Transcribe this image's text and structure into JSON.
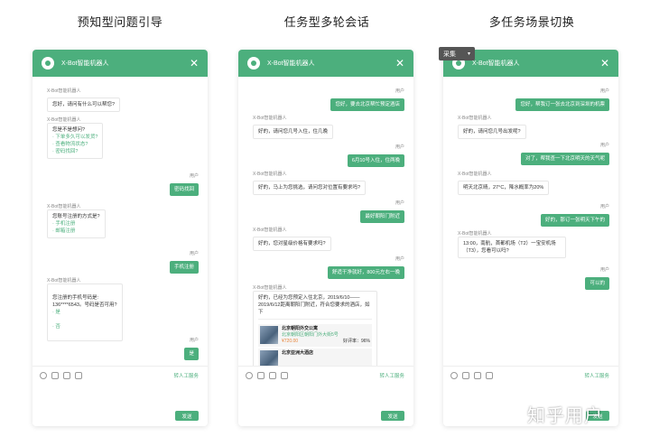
{
  "columns": [
    {
      "title": "预知型问题引导",
      "window_title": "X-Bot智能机器人",
      "messages": [
        {
          "side": "left",
          "sender": "X-Bot智能机器人",
          "text": "您好，请问有什么可以帮您?"
        },
        {
          "side": "left",
          "sender": "X-Bot智能机器人",
          "text": "您是不是想问?",
          "options": [
            "· 下单多久可以发货?",
            "· 查看物流状态?",
            "· 密码找回?"
          ]
        },
        {
          "side": "right",
          "sender": "用户",
          "text": "密码找回"
        },
        {
          "side": "left",
          "sender": "X-Bot智能机器人",
          "text": "您账号注册的方式是?",
          "options": [
            "· 手机注册",
            "· 邮箱注册"
          ]
        },
        {
          "side": "right",
          "sender": "用户",
          "text": "手机注册"
        },
        {
          "side": "left",
          "sender": "X-Bot智能机器人",
          "text": "您注册的手机号码是:\n136****6543。号码是否可用?",
          "options": [
            "· 是",
            "· 否"
          ]
        },
        {
          "side": "right",
          "sender": "用户",
          "text": "是"
        }
      ],
      "human_service": "转人工服务",
      "send": "发送"
    },
    {
      "title": "任务型多轮会话",
      "window_title": "X-Bot智能机器人",
      "messages": [
        {
          "side": "right",
          "sender": "用户",
          "text": "您好，要去北京帮忙预定酒店"
        },
        {
          "side": "left",
          "sender": "X-Bot智能机器人",
          "text": "好的，请问您几号入住，住几晚"
        },
        {
          "side": "right",
          "sender": "用户",
          "text": "6月10号入住，住两晚"
        },
        {
          "side": "left",
          "sender": "X-Bot智能机器人",
          "text": "好的，马上为您挑选，请问您对位置有要求吗?"
        },
        {
          "side": "right",
          "sender": "用户",
          "text": "最好朝阳门附近"
        },
        {
          "side": "left",
          "sender": "X-Bot智能机器人",
          "text": "好的，您对星级价格有要求吗?"
        },
        {
          "side": "right",
          "sender": "用户",
          "text": "舒适干净就好，800元左右一晚"
        },
        {
          "side": "left",
          "sender": "X-Bot智能机器人",
          "text": "好的，已经为您预定入住北京，2019/6/10——2019/6/12距离朝阳门附近，符合您要求的酒店，如下"
        }
      ],
      "hotels": [
        {
          "name": "北京朝阳外交公寓",
          "address": "北京朝阳区朝阳门外大街5号",
          "price": "¥720.00",
          "rating": "好评率：96%"
        },
        {
          "name": "北京亚洲大酒店",
          "address": "",
          "price": "",
          "rating": ""
        }
      ],
      "human_service": "转人工服务",
      "send": "发送"
    },
    {
      "title": "多任务场景切换",
      "window_title": "X-Bot智能机器人",
      "messages": [
        {
          "side": "right",
          "sender": "用户",
          "text": "您好，帮我订一张去北京到深圳的机票"
        },
        {
          "side": "left",
          "sender": "X-Bot智能机器人",
          "text": "好的，请问您几号出发呢?"
        },
        {
          "side": "right",
          "sender": "用户",
          "text": "对了，帮我查一下北京明天的天气呢"
        },
        {
          "side": "left",
          "sender": "X-Bot智能机器人",
          "text": "明天北京晴，27°C，降水概率为20%"
        },
        {
          "side": "right",
          "sender": "用户",
          "text": "好的，那订一张明天下午的"
        },
        {
          "side": "left",
          "sender": "X-Bot智能机器人",
          "text": "13:00，南航，首都机场（T2）一宝安机场（T3），您看可以吗?"
        },
        {
          "side": "right",
          "sender": "用户",
          "text": "可以的"
        }
      ],
      "human_service": "转人工服务",
      "send": "发送"
    }
  ],
  "collect_button": "采集",
  "watermark": "知乎用户",
  "colors": {
    "accent": "#4caf7d",
    "header": "#4caf7d"
  }
}
